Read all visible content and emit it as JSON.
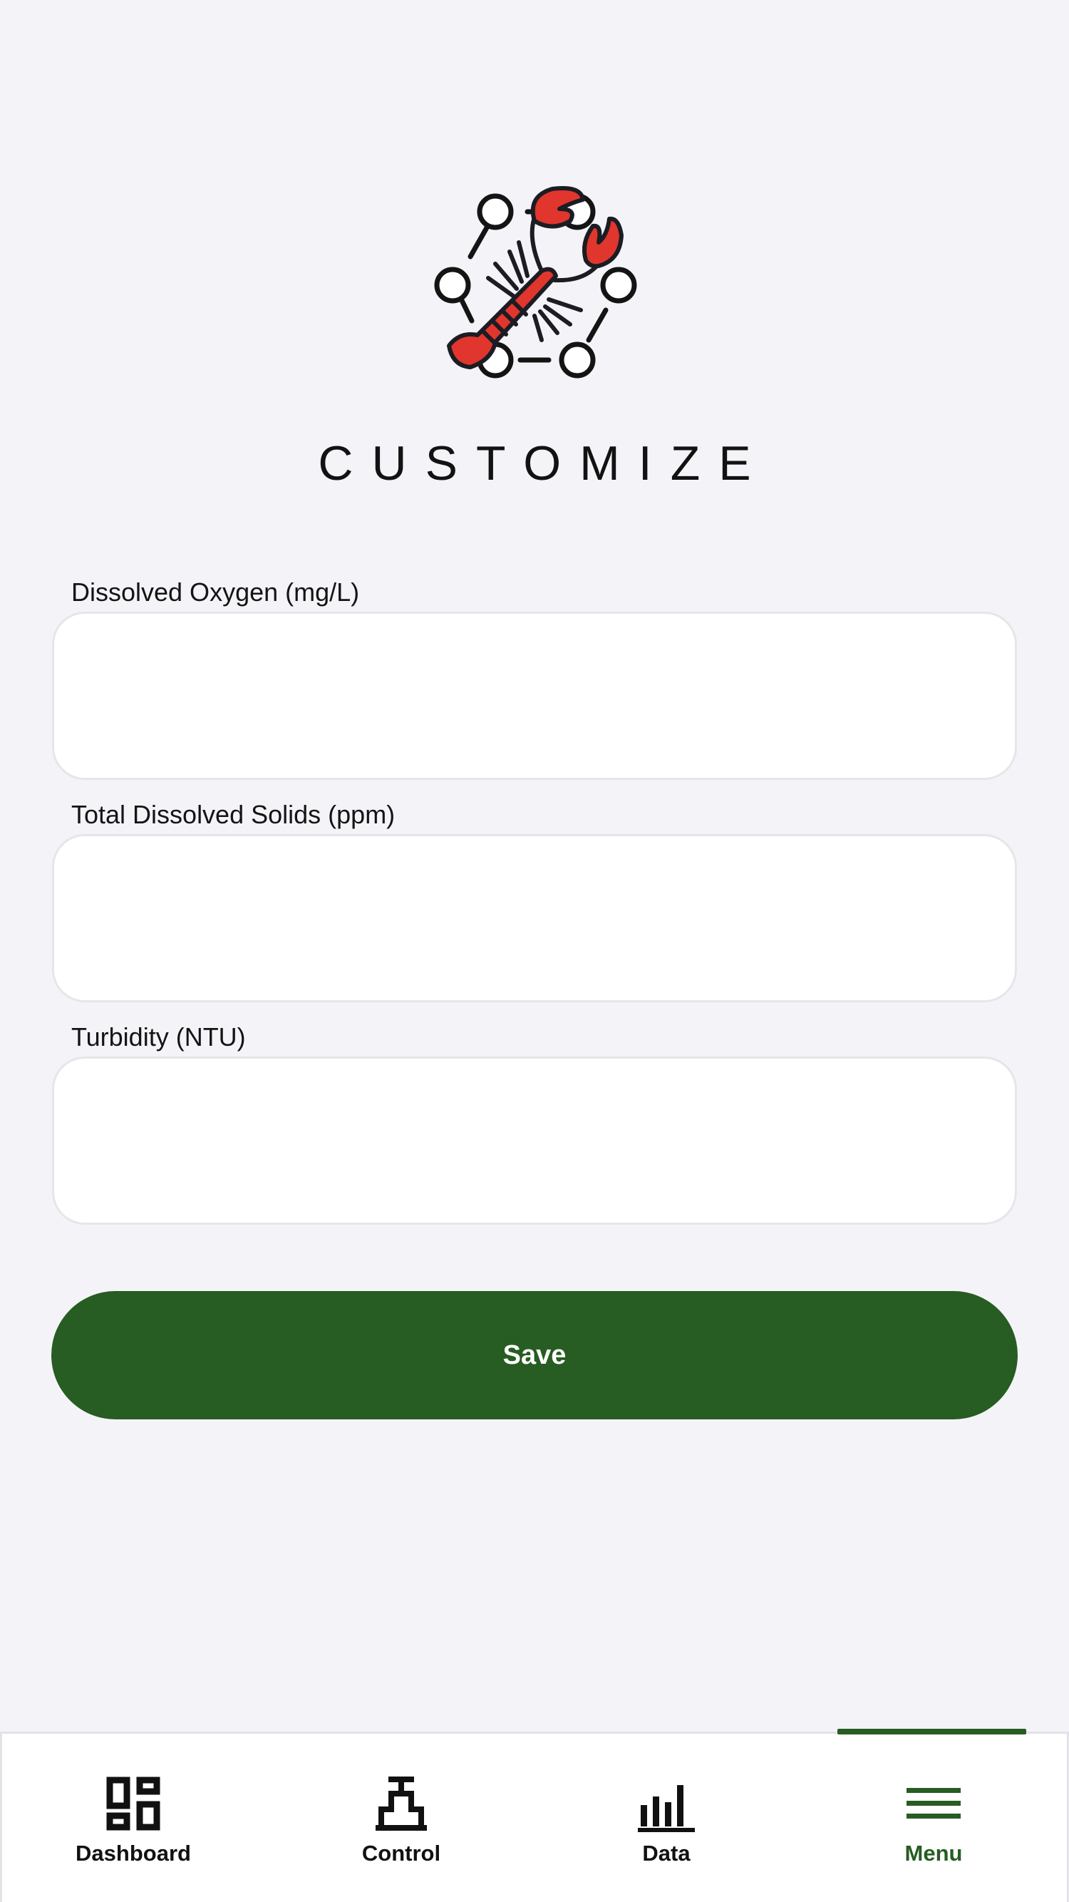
{
  "page": {
    "title": "CUSTOMIZE"
  },
  "form": {
    "fields": [
      {
        "label": "Dissolved Oxygen (mg/L)",
        "value": "",
        "placeholder": ""
      },
      {
        "label": "Total Dissolved Solids (ppm)",
        "value": "",
        "placeholder": ""
      },
      {
        "label": "Turbidity (NTU)",
        "value": "",
        "placeholder": ""
      }
    ],
    "save_label": "Save"
  },
  "nav": {
    "items": [
      {
        "label": "Dashboard",
        "icon": "dashboard-icon"
      },
      {
        "label": "Control",
        "icon": "faucet-icon"
      },
      {
        "label": "Data",
        "icon": "bar-chart-icon"
      },
      {
        "label": "Menu",
        "icon": "hamburger-menu-icon"
      }
    ],
    "active": "Menu"
  },
  "colors": {
    "background": "#f4f4f8",
    "accent": "#275c22",
    "lobster": "#e0362d",
    "input_border": "#e6e6ea"
  }
}
